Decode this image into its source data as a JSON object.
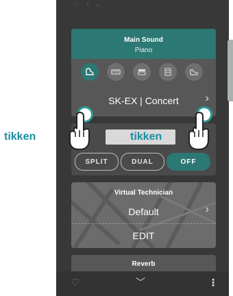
{
  "main_sound": {
    "title": "Main Sound",
    "subtitle": "Piano",
    "sound_name": "SK-EX | Concert",
    "categories": [
      {
        "icon": "grand-piano-icon"
      },
      {
        "icon": "e-piano-icon"
      },
      {
        "icon": "organ-icon"
      },
      {
        "icon": "harpsichord-icon"
      },
      {
        "icon": "upright-piano-icon"
      }
    ]
  },
  "mode": {
    "buttons": [
      "SPLIT",
      "DUAL",
      "OFF"
    ]
  },
  "overlay": {
    "tap_left": "tikken",
    "tap_right": "tikken"
  },
  "virtual_technician": {
    "title": "Virtual Technician",
    "value": "Default",
    "edit_label": "EDIT"
  },
  "reverb": {
    "title": "Reverb"
  },
  "colors": {
    "accent": "#2c7874",
    "overlay_text": "#1a8ea0"
  }
}
